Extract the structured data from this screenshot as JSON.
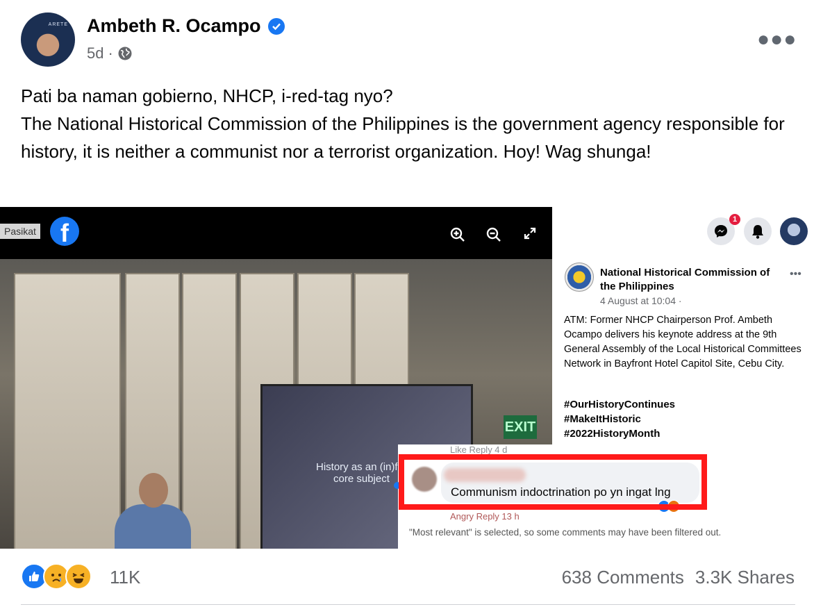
{
  "post": {
    "author": "Ambeth R. Ocampo",
    "time": "5d",
    "separator": "·",
    "text_lines": [
      "Pati ba naman gobierno, NHCP, i-red-tag nyo?",
      "The National Historical Commission of the Philippines is the government agency responsible for history, it is neither a communist nor a terrorist organization.  Hoy! Wag shunga!"
    ]
  },
  "image": {
    "watermark_label": "Pasikat",
    "slide_text": "History as an (in)for\ncore subject",
    "exit_sign": "EXIT",
    "notification_count": "1",
    "nhcp_post": {
      "page_name": "National Historical Commission of the Philippines",
      "meta": "4 August at 10:04 ·",
      "text": "ATM: Former NHCP Chairperson Prof. Ambeth Ocampo delivers his keynote address at the 9th General Assembly of the Local Historical Committees Network in Bayfront Hotel Capitol Site, Cebu City.",
      "hashtags": [
        "#OurHistoryContinues",
        "#MakeItHistoric",
        "#2022HistoryMonth"
      ]
    },
    "comment": {
      "text": "Communism indoctrination po yn ingat lng",
      "ghost_top": "Like   Reply   4 d",
      "ghost_bottom": "Angry   Reply   13 h",
      "filter_note": "\"Most relevant\" is selected, so some comments may have been filtered out."
    },
    "accent_highlight": "#ff1a1a"
  },
  "footer": {
    "reaction_count": "11K",
    "comments": "638 Comments",
    "shares": "3.3K Shares"
  },
  "icons": [
    "verified-badge-icon",
    "globe-icon",
    "more-options-icon",
    "zoom-in-icon",
    "zoom-out-icon",
    "fullscreen-icon",
    "messenger-icon",
    "bell-icon",
    "like-reaction-icon",
    "sad-reaction-icon",
    "haha-reaction-icon"
  ],
  "colors": {
    "facebook_blue": "#1877f2",
    "secondary_text": "#65676b"
  }
}
